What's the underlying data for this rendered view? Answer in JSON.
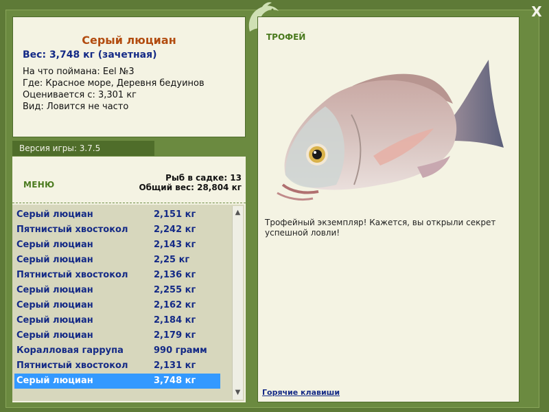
{
  "window": {
    "close_label": "X"
  },
  "colors": {
    "frame": "#5e7a37",
    "panel": "#f4f3e3",
    "accent_title": "#b24c10",
    "text_blue": "#142a86",
    "selection": "#3399ff"
  },
  "fish_info": {
    "title": "Серый люциан",
    "weight": "Вес: 3,748 кг (зачетная)",
    "bait": "На что поймана: Eel №3",
    "location": "Где: Красное море, Деревня бедуинов",
    "valued_from": "Оценивается с: 3,301 кг",
    "frequency": "Вид: Ловится не часто"
  },
  "version": "Версия игры: 3.7.5",
  "menu_label": "МЕНЮ",
  "keep": {
    "count": "Рыб в садке: 13",
    "total_weight": "Общий вес: 28,804 кг"
  },
  "catch_list": [
    {
      "name": "Серый люциан",
      "weight": "2,151 кг"
    },
    {
      "name": "Пятнистый хвостокол",
      "weight": "2,242 кг"
    },
    {
      "name": "Серый люциан",
      "weight": "2,143 кг"
    },
    {
      "name": "Серый люциан",
      "weight": "2,25 кг"
    },
    {
      "name": "Пятнистый хвостокол",
      "weight": "2,136 кг"
    },
    {
      "name": "Серый люциан",
      "weight": "2,255 кг"
    },
    {
      "name": "Серый люциан",
      "weight": "2,162 кг"
    },
    {
      "name": "Серый люциан",
      "weight": "2,184 кг"
    },
    {
      "name": "Серый люциан",
      "weight": "2,179 кг"
    },
    {
      "name": "Коралловая гаррупа",
      "weight": "990 грамм"
    },
    {
      "name": "Пятнистый хвостокол",
      "weight": "2,131 кг"
    },
    {
      "name": "Серый люциан",
      "weight": "3,748 кг"
    }
  ],
  "selected_index": 11,
  "trophy": {
    "label": "ТРОФЕЙ",
    "text": "Трофейный экземпляр! Кажется, вы открыли секрет успешной ловли!",
    "image_icon": "grey-snapper-fish-image"
  },
  "hotkeys_link": "Горячие клавиши",
  "logo_icon": "dolphin-logo-icon"
}
